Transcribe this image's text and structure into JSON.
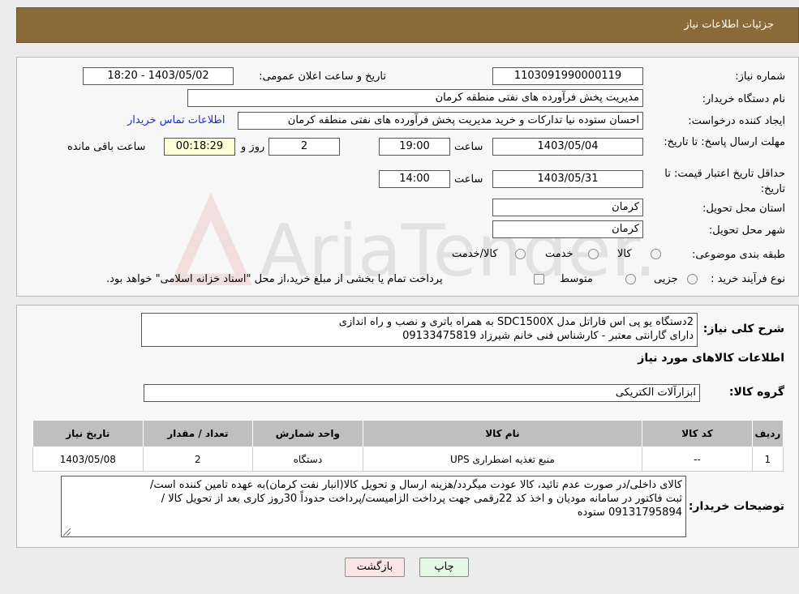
{
  "header": {
    "title": "جزئیات اطلاعات نیاز"
  },
  "watermark": {
    "text": "AriaTender.neT"
  },
  "form": {
    "need_number_label": "شماره نیاز:",
    "need_number": "1103091990000119",
    "announce_label": "تاریخ و ساعت اعلان عمومی:",
    "announce_value": "1403/05/02 - 18:20",
    "buyer_org_label": "نام دستگاه خریدار:",
    "buyer_org": "مدیریت پخش فرآورده های نفتی منطقه کرمان",
    "creator_label": "ایجاد کننده درخواست:",
    "creator": "احسان  ستوده نیا  تدارکات و خرید  مدیریت پخش فرآورده های نفتی منطقه کرمان",
    "contact_link": "اطلاعات تماس خریدار",
    "reply_deadline_label": "مهلت ارسال پاسخ: تا تاریخ:",
    "reply_date": "1403/05/04",
    "time_label": "ساعت",
    "reply_time": "19:00",
    "days_value": "2",
    "days_label": "روز و",
    "remaining_value": "00:18:29",
    "remaining_label": "ساعت باقی مانده",
    "price_validity_label": "حداقل تاریخ اعتبار قیمت: تا تاریخ:",
    "price_date": "1403/05/31",
    "price_time": "14:00",
    "province_label": "استان محل تحویل:",
    "province": "کرمان",
    "city_label": "شهر محل تحویل:",
    "city": "کرمان",
    "category_label": "طبقه بندی موضوعی:",
    "category_options": [
      "کالا",
      "خدمت",
      "کالا/خدمت"
    ],
    "process_label": "نوع فرآیند خرید :",
    "process_options": [
      "جزیی",
      "متوسط"
    ],
    "process_note": "پرداخت تمام یا بخشی از مبلغ خرید،از محل \"اسناد خزانه اسلامی\" خواهد بود."
  },
  "details": {
    "summary_label": "شرح کلی نیاز:",
    "summary_lines": [
      "2دستگاه یو پی اس فاراتل مدل SDC1500X به همراه باتری و نصب و راه اندازی",
      "دارای گارانتی معتبر - کارشناس فنی خانم شیرزاد 09133475819"
    ],
    "goods_info_title": "اطلاعات کالاهای مورد نیاز",
    "goods_group_label": "گروه کالا:",
    "goods_group": "ابزارآلات الکتریکی",
    "table": {
      "headers": [
        "ردیف",
        "کد کالا",
        "نام کالا",
        "واحد شمارش",
        "تعداد / مقدار",
        "تاریخ نیاز"
      ],
      "rows": [
        [
          "1",
          "--",
          "منبع تغذیه اضطراری UPS",
          "دستگاه",
          "2",
          "1403/05/08"
        ]
      ]
    },
    "buyer_notes_label": "توضیحات خریدار:",
    "buyer_notes_lines": [
      "کالای داخلی/در صورت عدم تائید، کالا عودت میگردد/هزینه ارسال و تحویل کالا(انبار نفت کرمان)به عهده تامین کننده است/",
      "ثبت فاکتور در سامانه مودیان و اخذ کد 22رقمی جهت پرداخت الزامیست/پرداخت حدوداً 30روز کاری بعد از تحویل کالا /",
      "09131795894 ستوده"
    ]
  },
  "buttons": {
    "print": "چاپ",
    "back": "بازگشت"
  }
}
